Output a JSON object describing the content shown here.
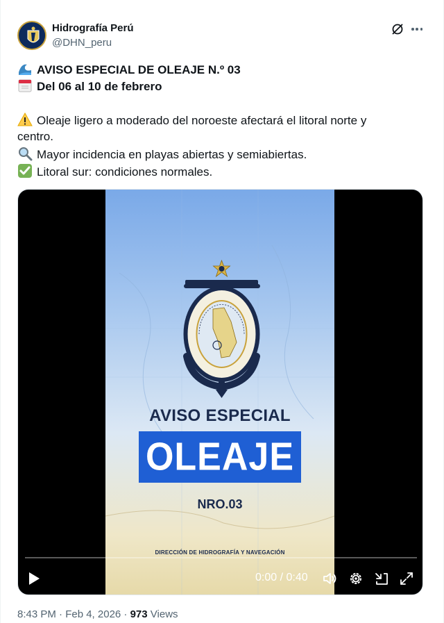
{
  "author": {
    "name": "Hidrografía Perú",
    "handle": "@DHN_peru"
  },
  "icons": {
    "header": [
      "grok-icon",
      "more-icon"
    ],
    "lines": [
      "wave-emoji",
      "calendar-emoji",
      "warning-emoji",
      "magnifier-emoji",
      "check-emoji"
    ],
    "controls": [
      "play-icon",
      "volume-icon",
      "settings-icon",
      "minimize-icon",
      "fullscreen-icon"
    ]
  },
  "tweet": {
    "line1": "AVISO ESPECIAL DE OLEAJE N.º 03",
    "line2": "Del 06 al 10 de febrero",
    "line3": "Oleaje ligero a moderado del noroeste afectará el litoral norte y",
    "line4": "centro.",
    "line5": "Mayor incidencia en playas abiertas y semiabiertas.",
    "line6": "Litoral sur: condiciones normales."
  },
  "video": {
    "title_small": "AVISO ESPECIAL",
    "title_big": "OLEAJE",
    "number": "NRO.03",
    "credit": "DIRECCIÓN DE HIDROGRAFÍA Y NAVEGACIÓN",
    "time": "0:00 / 0:40",
    "progress": 0
  },
  "footer": {
    "time": "8:43 PM · Feb 4, 2026 · ",
    "views_count": "973",
    "views_label": " Views"
  },
  "colors": {
    "text": "#0f1419",
    "secondary": "#536471",
    "banner_blue": "#1f5fd4",
    "navy": "#1a2a4d"
  }
}
